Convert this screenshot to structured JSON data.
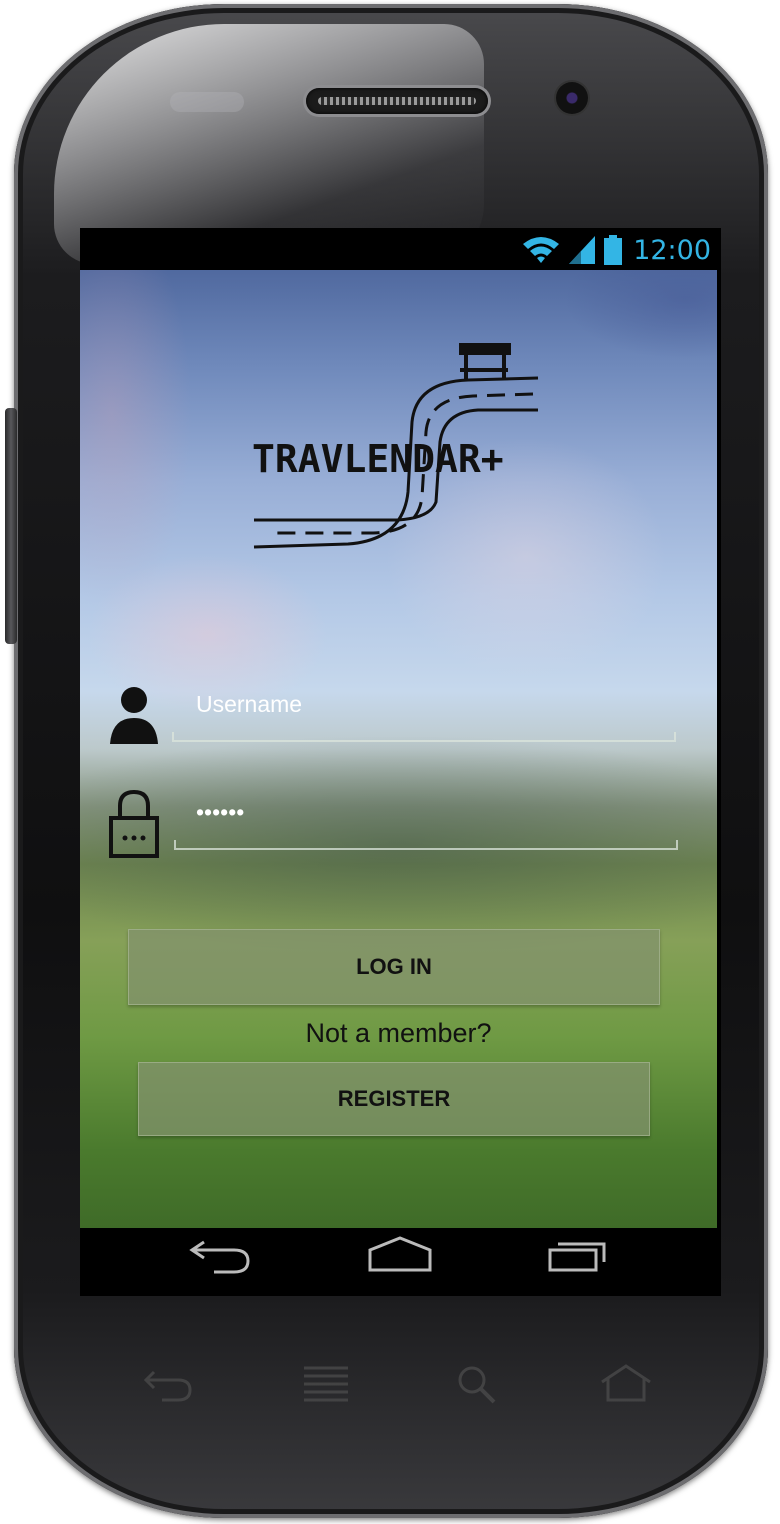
{
  "status_bar": {
    "time": "12:00",
    "icons": [
      "wifi-icon",
      "signal-icon",
      "battery-icon"
    ],
    "accent_color": "#33b5e5"
  },
  "logo": {
    "text": "TRAVLENDAR+"
  },
  "login_form": {
    "username_placeholder": "Username",
    "username_value": "",
    "password_value": "••••••",
    "login_label": "LOG IN",
    "not_member_text": "Not a member?",
    "register_label": "REGISTER"
  },
  "nav_bar": {
    "icons": [
      "back-icon",
      "home-icon",
      "recent-apps-icon"
    ]
  },
  "hardware_keys": {
    "icons": [
      "back-icon",
      "menu-icon",
      "search-icon",
      "home-icon"
    ]
  }
}
